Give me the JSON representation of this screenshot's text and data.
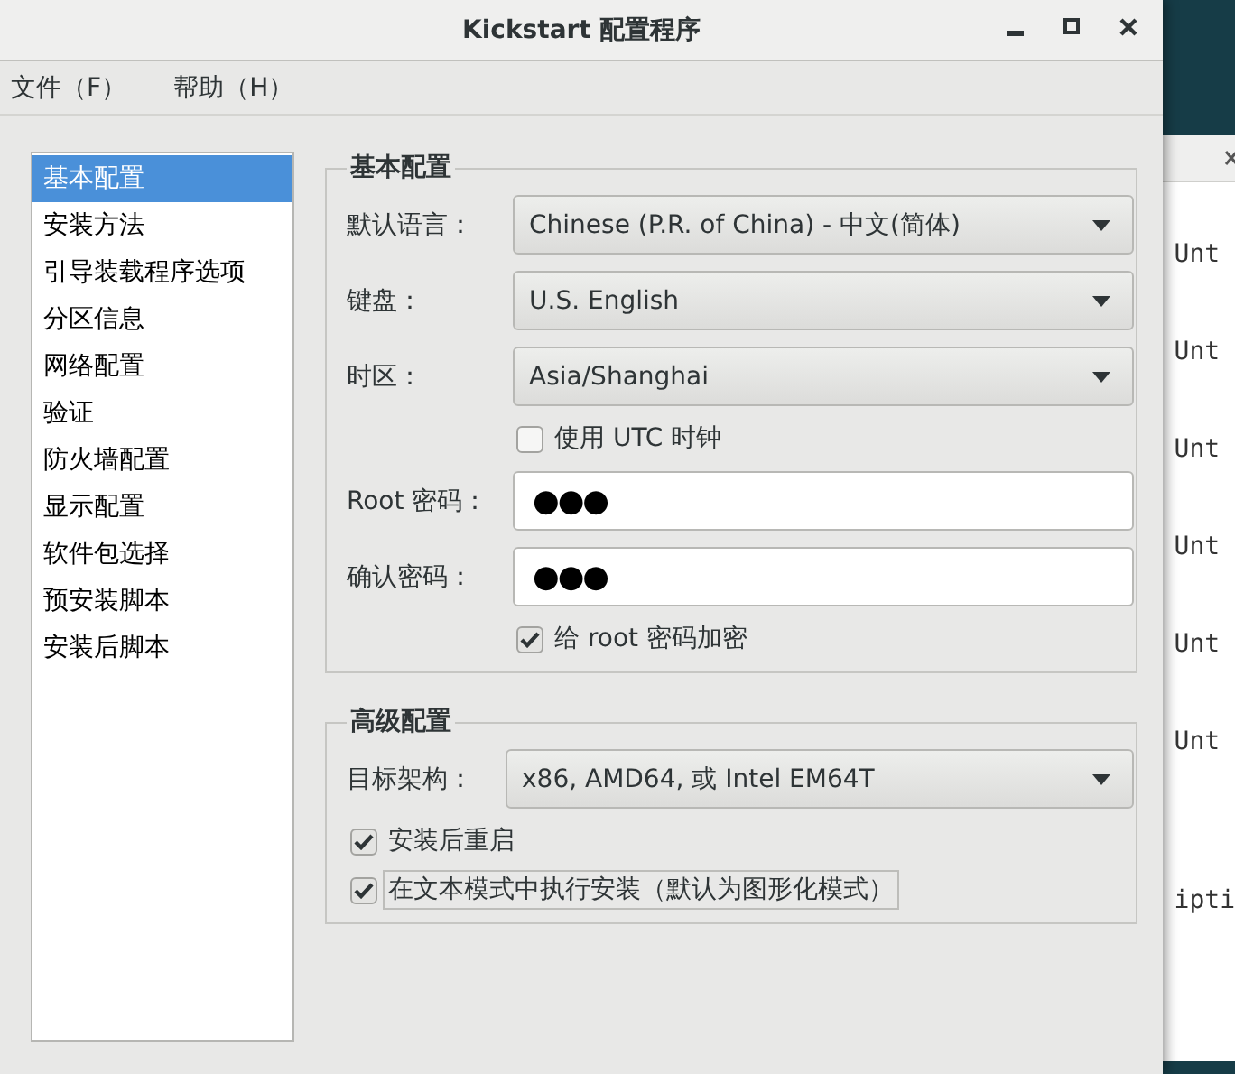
{
  "window": {
    "title": "Kickstart 配置程序"
  },
  "menu": [
    {
      "label": "文件（F）"
    },
    {
      "label": "帮助（H）"
    }
  ],
  "sidebar": {
    "items": [
      {
        "label": "基本配置",
        "selected": true
      },
      {
        "label": "安装方法",
        "selected": false
      },
      {
        "label": "引导装载程序选项",
        "selected": false
      },
      {
        "label": "分区信息",
        "selected": false
      },
      {
        "label": "网络配置",
        "selected": false
      },
      {
        "label": "验证",
        "selected": false
      },
      {
        "label": "防火墙配置",
        "selected": false
      },
      {
        "label": "显示配置",
        "selected": false
      },
      {
        "label": "软件包选择",
        "selected": false
      },
      {
        "label": "预安装脚本",
        "selected": false
      },
      {
        "label": "安装后脚本",
        "selected": false
      }
    ]
  },
  "sections": [
    {
      "title": "基本配置",
      "fields": [
        {
          "kind": "dropdown",
          "label": "默认语言：",
          "value": "Chinese (P.R. of China) - 中文(简体)"
        },
        {
          "kind": "dropdown",
          "label": "键盘：",
          "value": "U.S. English"
        },
        {
          "kind": "dropdown",
          "label": "时区：",
          "value": "Asia/Shanghai"
        },
        {
          "kind": "checkbox",
          "label": "使用  UTC 时钟",
          "checked": false,
          "focused": false
        },
        {
          "kind": "password",
          "label": "Root 密码：",
          "value": "●●●"
        },
        {
          "kind": "password",
          "label": "确认密码：",
          "value": "●●●"
        },
        {
          "kind": "checkbox",
          "label": "给  root 密码加密",
          "checked": true,
          "focused": false
        }
      ]
    },
    {
      "title": "高级配置",
      "fields": [
        {
          "kind": "dropdown",
          "label": "目标架构：",
          "value": "x86, AMD64, 或  Intel EM64T"
        },
        {
          "kind": "checkbox",
          "label": "安装后重启",
          "checked": true,
          "focused": false
        },
        {
          "kind": "checkbox",
          "label": "在文本模式中执行安装（默认为图形化模式）",
          "checked": true,
          "focused": true
        }
      ]
    }
  ],
  "background_window": {
    "lines": [
      {
        "text": "Unt",
        "kind": "line"
      },
      {
        "text": "Unt",
        "kind": "line"
      },
      {
        "text": "Unt",
        "kind": "line"
      },
      {
        "text": "Unt",
        "kind": "line"
      },
      {
        "text": "Unt",
        "kind": "line"
      },
      {
        "text": "Unt",
        "kind": "line"
      },
      {
        "text": "ipti",
        "kind": "gap"
      }
    ]
  }
}
